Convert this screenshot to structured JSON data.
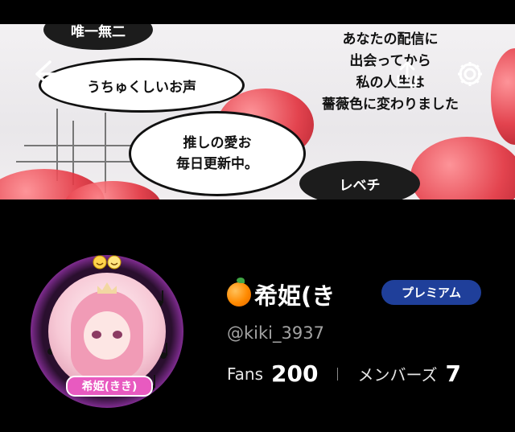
{
  "banner": {
    "bubbles": {
      "tag_top": "唯一無二",
      "voice": "うちゅくしいお声",
      "live_line1": "推しの愛お",
      "live_line2": "毎日更新中。",
      "level": "レベチ",
      "shout_line1": "あなたの配信に",
      "shout_line2": "出会ってから",
      "shout_line3": "私の人生は",
      "shout_line4": "薔薇色に変わりました"
    }
  },
  "nav": {
    "back_icon": "arrow-left-icon",
    "share_icon": "share-upload-icon",
    "settings_icon": "gear-icon"
  },
  "profile": {
    "avatar_name": "希姫(きき)",
    "display_name": "希姫(き",
    "badge": "プレミアム",
    "handle": "@kiki_3937",
    "stats": [
      {
        "label": "Fans",
        "value": "200"
      },
      {
        "label": "メンバーズ",
        "value": "7"
      }
    ],
    "colors": {
      "badge_bg": "#1f3f9a",
      "handle": "#a3a3a3",
      "background": "#000000"
    }
  }
}
